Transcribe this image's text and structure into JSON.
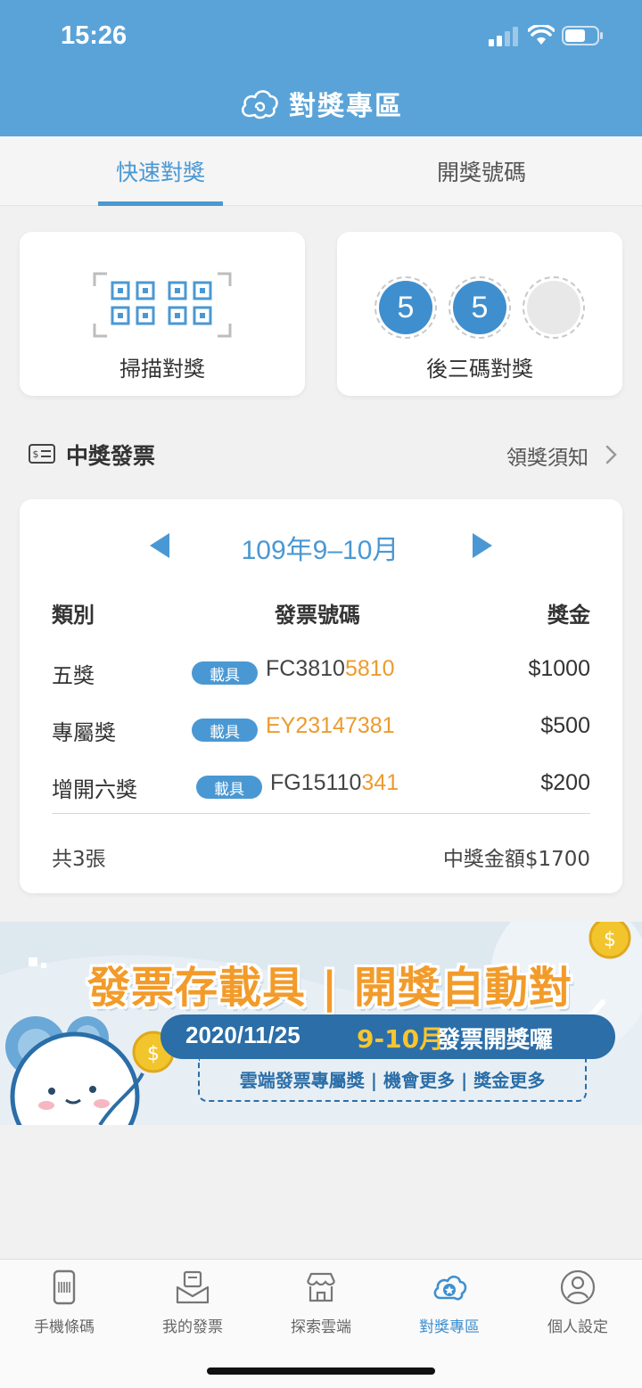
{
  "status_bar": {
    "time": "15:26"
  },
  "header": {
    "title": "對獎專區"
  },
  "tabs": [
    {
      "label": "快速對獎",
      "active": true
    },
    {
      "label": "開獎號碼",
      "active": false
    }
  ],
  "quick_cards": {
    "scan": {
      "label": "掃描對獎"
    },
    "last3": {
      "label": "後三碼對獎",
      "digits": [
        "5",
        "5",
        ""
      ]
    }
  },
  "winning_section": {
    "title": "中獎發票",
    "notice_link": "領獎須知"
  },
  "prize_table": {
    "period": "109年9–10月",
    "headers": {
      "category": "類別",
      "number": "發票號碼",
      "amount": "獎金"
    },
    "rows": [
      {
        "category": "五獎",
        "badge": "載具",
        "number_plain": "FC3810",
        "number_highlight": "5810",
        "amount": "$1000"
      },
      {
        "category": "專屬獎",
        "badge": "載具",
        "number_plain": "",
        "number_highlight": "EY23147381",
        "amount": "$500"
      },
      {
        "category": "增開六獎",
        "badge": "載具",
        "number_plain": "FG15110",
        "number_highlight": "341",
        "amount": "$200"
      }
    ],
    "count_text": "共3張",
    "total_text": "中獎金額$1700"
  },
  "banner": {
    "headline": "發票存載具 | 開獎自動對",
    "date": "2020/11/25",
    "month": "9-10月",
    "draw_text": "發票開獎囉",
    "subline": "雲端發票專屬獎 | 機會更多 | 獎金更多"
  },
  "bottom_nav": [
    {
      "label": "手機條碼",
      "icon": "barcode-phone-icon",
      "active": false
    },
    {
      "label": "我的發票",
      "icon": "invoice-envelope-icon",
      "active": false
    },
    {
      "label": "探索雲端",
      "icon": "store-icon",
      "active": false
    },
    {
      "label": "對獎專區",
      "icon": "cloud-prize-icon",
      "active": true
    },
    {
      "label": "個人設定",
      "icon": "person-icon",
      "active": false
    }
  ],
  "colors": {
    "primary": "#4a98d3",
    "header": "#5aa3d8",
    "highlight": "#ec9b2e"
  }
}
